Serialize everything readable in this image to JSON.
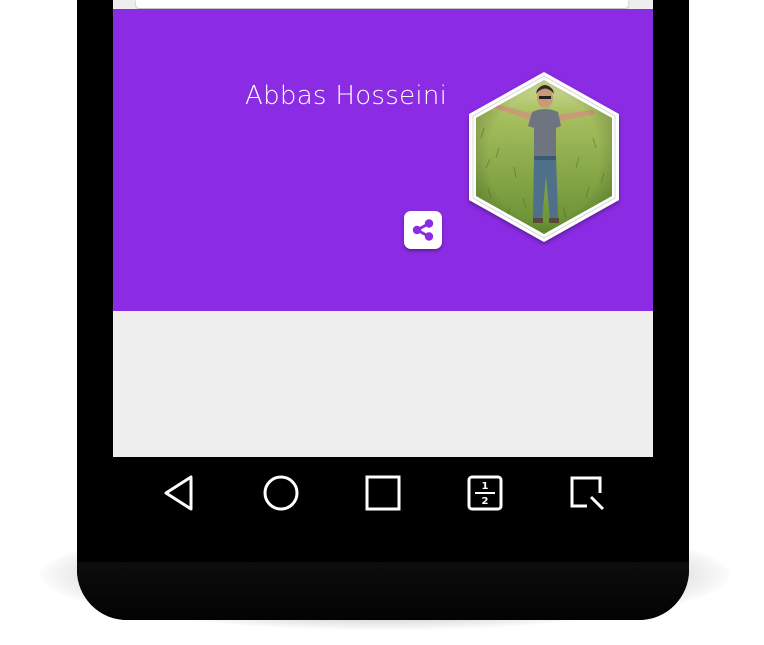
{
  "profile": {
    "name": "Abbas Hosseini",
    "photo": "man-in-grass-field-arms-outstretched"
  },
  "share": {
    "icon": "share-icon"
  },
  "nav": {
    "buttons": [
      {
        "icon": "back-triangle-icon"
      },
      {
        "icon": "home-circle-icon"
      },
      {
        "icon": "recents-square-icon"
      },
      {
        "icon": "split-screen-icon",
        "labels": [
          "1",
          "2"
        ]
      },
      {
        "icon": "capture-screen-icon"
      }
    ]
  },
  "colors": {
    "card": "#8b2be3",
    "screen_bg": "#eeeeee",
    "phone": "#000000",
    "text": "#ffffff"
  }
}
